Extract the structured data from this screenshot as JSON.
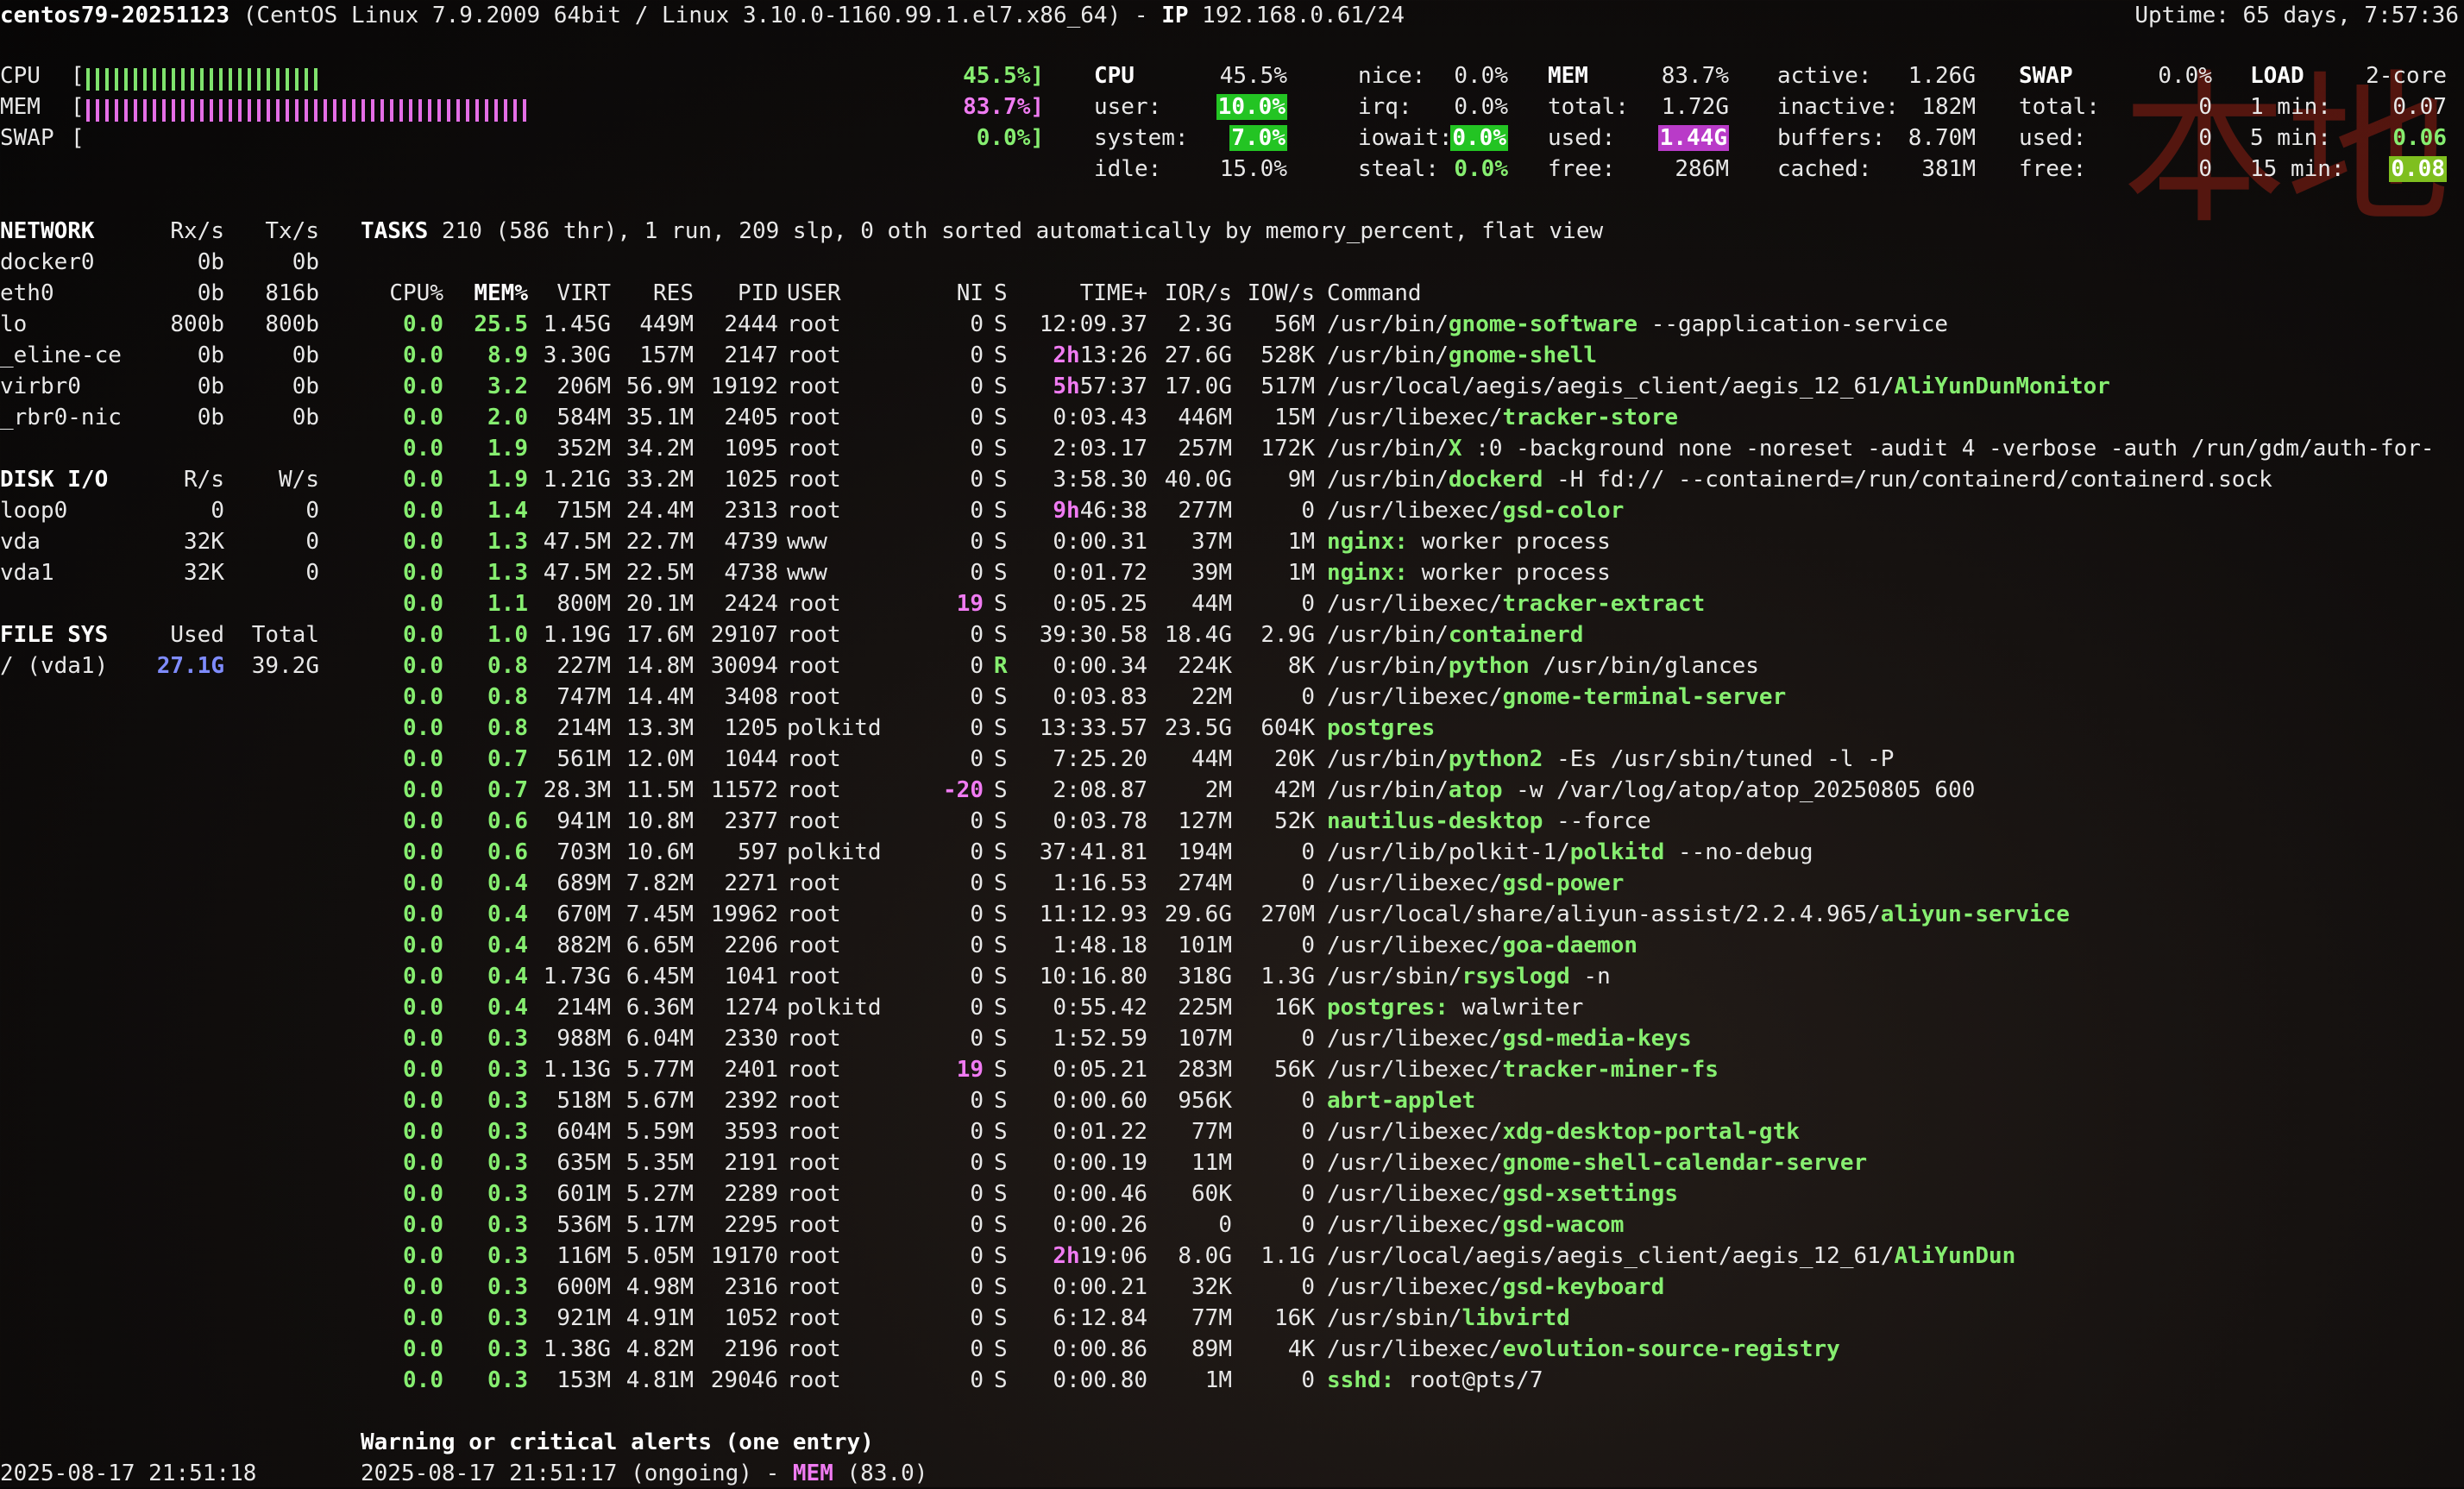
{
  "header": {
    "hostname": "centos79-20251123",
    "os": "(CentOS Linux 7.9.2009 64bit / Linux 3.10.0-1160.99.1.el7.x86_64) - ",
    "ip_label": "IP",
    "ip": "192.168.0.61/24",
    "uptime": "Uptime: 65 days, 7:57:36"
  },
  "quicklook": {
    "cpu_label": "CPU",
    "cpu_pct": "45.5%]",
    "cpu_fraction": 0.455,
    "mem_label": "MEM",
    "mem_pct": "83.7%]",
    "mem_fraction": 0.837,
    "swap_label": "SWAP",
    "swap_pct": "0.0%]",
    "swap_fraction": 0.0,
    "bracket_open": "[",
    "colors": {
      "cpu_bar": "#7fe36d",
      "mem_bar": "#e46ee6"
    }
  },
  "cpu": {
    "title": "CPU",
    "total": "45.5%",
    "user_label": "user:",
    "user": "10.0%",
    "system_label": "system:",
    "system": "7.0%",
    "idle_label": "idle:",
    "idle": "15.0%",
    "nice_label": "nice:",
    "nice": "0.0%",
    "irq_label": "irq:",
    "irq": "0.0%",
    "iowait_label": "iowait:",
    "iowait": "0.0%",
    "steal_label": "steal:",
    "steal": "0.0%"
  },
  "mem": {
    "title": "MEM",
    "total_pct": "83.7%",
    "total_label": "total:",
    "total": "1.72G",
    "used_label": "used:",
    "used": "1.44G",
    "free_label": "free:",
    "free": "286M",
    "active_label": "active:",
    "active": "1.26G",
    "inactive_label": "inactive:",
    "inactive": "182M",
    "buffers_label": "buffers:",
    "buffers": "8.70M",
    "cached_label": "cached:",
    "cached": "381M"
  },
  "swap": {
    "title": "SWAP",
    "pct": "0.0%",
    "total_label": "total:",
    "total": "0",
    "used_label": "used:",
    "used": "0",
    "free_label": "free:",
    "free": "0"
  },
  "load": {
    "title": "LOAD",
    "cores": "2-core",
    "min1_label": "1 min:",
    "min1": "0.07",
    "min5_label": "5 min:",
    "min5": "0.06",
    "min15_label": "15 min:",
    "min15": "0.08"
  },
  "watermark": "本地",
  "network": {
    "title": "NETWORK",
    "rx_label": "Rx/s",
    "tx_label": "Tx/s",
    "rows": [
      {
        "name": "docker0",
        "rx": "0b",
        "tx": "0b"
      },
      {
        "name": "eth0",
        "rx": "0b",
        "tx": "816b"
      },
      {
        "name": "lo",
        "rx": "800b",
        "tx": "800b"
      },
      {
        "name": "_eline-ce",
        "rx": "0b",
        "tx": "0b"
      },
      {
        "name": "virbr0",
        "rx": "0b",
        "tx": "0b"
      },
      {
        "name": "_rbr0-nic",
        "rx": "0b",
        "tx": "0b"
      }
    ]
  },
  "diskio": {
    "title": "DISK I/O",
    "r_label": "R/s",
    "w_label": "W/s",
    "rows": [
      {
        "name": "loop0",
        "r": "0",
        "w": "0"
      },
      {
        "name": "vda",
        "r": "32K",
        "w": "0"
      },
      {
        "name": "vda1",
        "r": "32K",
        "w": "0"
      }
    ]
  },
  "fs": {
    "title": "FILE SYS",
    "used_label": "Used",
    "total_label": "Total",
    "rows": [
      {
        "name": "/ (vda1)",
        "used": "27.1G",
        "total": "39.2G"
      }
    ]
  },
  "tasks": {
    "label": "TASKS",
    "summary": "210 (586 thr), 1 run, 209 slp, 0 oth sorted automatically by memory_percent, flat view"
  },
  "proc_headers": [
    "CPU%",
    "MEM%",
    "VIRT",
    "RES",
    "PID",
    "USER",
    "NI",
    "S",
    "TIME+",
    "IOR/s",
    "IOW/s",
    "Command"
  ],
  "processes": [
    {
      "cpu": "0.0",
      "mem": "25.5",
      "virt": "1.45G",
      "res": "449M",
      "pid": "2444",
      "user": "root",
      "ni": "0",
      "s": "S",
      "time_hi": "",
      "time": "12:09.37",
      "ior": "2.3G",
      "iow": "56M",
      "cmd_pre": "/usr/bin/",
      "cmd_bold": "gnome-software",
      "cmd_post": " --gapplication-service"
    },
    {
      "cpu": "0.0",
      "mem": "8.9",
      "virt": "3.30G",
      "res": "157M",
      "pid": "2147",
      "user": "root",
      "ni": "0",
      "s": "S",
      "time_hi": "2h",
      "time": "13:26",
      "ior": "27.6G",
      "iow": "528K",
      "cmd_pre": "/usr/bin/",
      "cmd_bold": "gnome-shell",
      "cmd_post": ""
    },
    {
      "cpu": "0.0",
      "mem": "3.2",
      "virt": "206M",
      "res": "56.9M",
      "pid": "19192",
      "user": "root",
      "ni": "0",
      "s": "S",
      "time_hi": "5h",
      "time": "57:37",
      "ior": "17.0G",
      "iow": "517M",
      "cmd_pre": "/usr/local/aegis/aegis_client/aegis_12_61/",
      "cmd_bold": "AliYunDunMonitor",
      "cmd_post": ""
    },
    {
      "cpu": "0.0",
      "mem": "2.0",
      "virt": "584M",
      "res": "35.1M",
      "pid": "2405",
      "user": "root",
      "ni": "0",
      "s": "S",
      "time_hi": "",
      "time": "0:03.43",
      "ior": "446M",
      "iow": "15M",
      "cmd_pre": "/usr/libexec/",
      "cmd_bold": "tracker-store",
      "cmd_post": ""
    },
    {
      "cpu": "0.0",
      "mem": "1.9",
      "virt": "352M",
      "res": "34.2M",
      "pid": "1095",
      "user": "root",
      "ni": "0",
      "s": "S",
      "time_hi": "",
      "time": "2:03.17",
      "ior": "257M",
      "iow": "172K",
      "cmd_pre": "/usr/bin/",
      "cmd_bold": "X",
      "cmd_post": " :0 -background none -noreset -audit 4 -verbose -auth /run/gdm/auth-for-"
    },
    {
      "cpu": "0.0",
      "mem": "1.9",
      "virt": "1.21G",
      "res": "33.2M",
      "pid": "1025",
      "user": "root",
      "ni": "0",
      "s": "S",
      "time_hi": "",
      "time": "3:58.30",
      "ior": "40.0G",
      "iow": "9M",
      "cmd_pre": "/usr/bin/",
      "cmd_bold": "dockerd",
      "cmd_post": " -H fd:// --containerd=/run/containerd/containerd.sock"
    },
    {
      "cpu": "0.0",
      "mem": "1.4",
      "virt": "715M",
      "res": "24.4M",
      "pid": "2313",
      "user": "root",
      "ni": "0",
      "s": "S",
      "time_hi": "9h",
      "time": "46:38",
      "ior": "277M",
      "iow": "0",
      "cmd_pre": "/usr/libexec/",
      "cmd_bold": "gsd-color",
      "cmd_post": ""
    },
    {
      "cpu": "0.0",
      "mem": "1.3",
      "virt": "47.5M",
      "res": "22.7M",
      "pid": "4739",
      "user": "www",
      "ni": "0",
      "s": "S",
      "time_hi": "",
      "time": "0:00.31",
      "ior": "37M",
      "iow": "1M",
      "cmd_pre": "",
      "cmd_bold": "nginx:",
      "cmd_post": " worker process"
    },
    {
      "cpu": "0.0",
      "mem": "1.3",
      "virt": "47.5M",
      "res": "22.5M",
      "pid": "4738",
      "user": "www",
      "ni": "0",
      "s": "S",
      "time_hi": "",
      "time": "0:01.72",
      "ior": "39M",
      "iow": "1M",
      "cmd_pre": "",
      "cmd_bold": "nginx:",
      "cmd_post": " worker process"
    },
    {
      "cpu": "0.0",
      "mem": "1.1",
      "virt": "800M",
      "res": "20.1M",
      "pid": "2424",
      "user": "root",
      "ni": "19",
      "s": "S",
      "time_hi": "",
      "time": "0:05.25",
      "ior": "44M",
      "iow": "0",
      "cmd_pre": "/usr/libexec/",
      "cmd_bold": "tracker-extract",
      "cmd_post": ""
    },
    {
      "cpu": "0.0",
      "mem": "1.0",
      "virt": "1.19G",
      "res": "17.6M",
      "pid": "29107",
      "user": "root",
      "ni": "0",
      "s": "S",
      "time_hi": "",
      "time": "39:30.58",
      "ior": "18.4G",
      "iow": "2.9G",
      "cmd_pre": "/usr/bin/",
      "cmd_bold": "containerd",
      "cmd_post": ""
    },
    {
      "cpu": "0.0",
      "mem": "0.8",
      "virt": "227M",
      "res": "14.8M",
      "pid": "30094",
      "user": "root",
      "ni": "0",
      "s": "R",
      "time_hi": "",
      "time": "0:00.34",
      "ior": "224K",
      "iow": "8K",
      "cmd_pre": "/usr/bin/",
      "cmd_bold": "python",
      "cmd_post": " /usr/bin/glances"
    },
    {
      "cpu": "0.0",
      "mem": "0.8",
      "virt": "747M",
      "res": "14.4M",
      "pid": "3408",
      "user": "root",
      "ni": "0",
      "s": "S",
      "time_hi": "",
      "time": "0:03.83",
      "ior": "22M",
      "iow": "0",
      "cmd_pre": "/usr/libexec/",
      "cmd_bold": "gnome-terminal-server",
      "cmd_post": ""
    },
    {
      "cpu": "0.0",
      "mem": "0.8",
      "virt": "214M",
      "res": "13.3M",
      "pid": "1205",
      "user": "polkitd",
      "ni": "0",
      "s": "S",
      "time_hi": "",
      "time": "13:33.57",
      "ior": "23.5G",
      "iow": "604K",
      "cmd_pre": "",
      "cmd_bold": "postgres",
      "cmd_post": ""
    },
    {
      "cpu": "0.0",
      "mem": "0.7",
      "virt": "561M",
      "res": "12.0M",
      "pid": "1044",
      "user": "root",
      "ni": "0",
      "s": "S",
      "time_hi": "",
      "time": "7:25.20",
      "ior": "44M",
      "iow": "20K",
      "cmd_pre": "/usr/bin/",
      "cmd_bold": "python2",
      "cmd_post": " -Es /usr/sbin/tuned -l -P"
    },
    {
      "cpu": "0.0",
      "mem": "0.7",
      "virt": "28.3M",
      "res": "11.5M",
      "pid": "11572",
      "user": "root",
      "ni": "-20",
      "s": "S",
      "time_hi": "",
      "time": "2:08.87",
      "ior": "2M",
      "iow": "42M",
      "cmd_pre": "/usr/bin/",
      "cmd_bold": "atop",
      "cmd_post": " -w /var/log/atop/atop_20250805 600"
    },
    {
      "cpu": "0.0",
      "mem": "0.6",
      "virt": "941M",
      "res": "10.8M",
      "pid": "2377",
      "user": "root",
      "ni": "0",
      "s": "S",
      "time_hi": "",
      "time": "0:03.78",
      "ior": "127M",
      "iow": "52K",
      "cmd_pre": "",
      "cmd_bold": "nautilus-desktop",
      "cmd_post": " --force"
    },
    {
      "cpu": "0.0",
      "mem": "0.6",
      "virt": "703M",
      "res": "10.6M",
      "pid": "597",
      "user": "polkitd",
      "ni": "0",
      "s": "S",
      "time_hi": "",
      "time": "37:41.81",
      "ior": "194M",
      "iow": "0",
      "cmd_pre": "/usr/lib/polkit-1/",
      "cmd_bold": "polkitd",
      "cmd_post": " --no-debug"
    },
    {
      "cpu": "0.0",
      "mem": "0.4",
      "virt": "689M",
      "res": "7.82M",
      "pid": "2271",
      "user": "root",
      "ni": "0",
      "s": "S",
      "time_hi": "",
      "time": "1:16.53",
      "ior": "274M",
      "iow": "0",
      "cmd_pre": "/usr/libexec/",
      "cmd_bold": "gsd-power",
      "cmd_post": ""
    },
    {
      "cpu": "0.0",
      "mem": "0.4",
      "virt": "670M",
      "res": "7.45M",
      "pid": "19962",
      "user": "root",
      "ni": "0",
      "s": "S",
      "time_hi": "",
      "time": "11:12.93",
      "ior": "29.6G",
      "iow": "270M",
      "cmd_pre": "/usr/local/share/aliyun-assist/2.2.4.965/",
      "cmd_bold": "aliyun-service",
      "cmd_post": ""
    },
    {
      "cpu": "0.0",
      "mem": "0.4",
      "virt": "882M",
      "res": "6.65M",
      "pid": "2206",
      "user": "root",
      "ni": "0",
      "s": "S",
      "time_hi": "",
      "time": "1:48.18",
      "ior": "101M",
      "iow": "0",
      "cmd_pre": "/usr/libexec/",
      "cmd_bold": "goa-daemon",
      "cmd_post": ""
    },
    {
      "cpu": "0.0",
      "mem": "0.4",
      "virt": "1.73G",
      "res": "6.45M",
      "pid": "1041",
      "user": "root",
      "ni": "0",
      "s": "S",
      "time_hi": "",
      "time": "10:16.80",
      "ior": "318G",
      "iow": "1.3G",
      "cmd_pre": "/usr/sbin/",
      "cmd_bold": "rsyslogd",
      "cmd_post": " -n"
    },
    {
      "cpu": "0.0",
      "mem": "0.4",
      "virt": "214M",
      "res": "6.36M",
      "pid": "1274",
      "user": "polkitd",
      "ni": "0",
      "s": "S",
      "time_hi": "",
      "time": "0:55.42",
      "ior": "225M",
      "iow": "16K",
      "cmd_pre": "",
      "cmd_bold": "postgres:",
      "cmd_post": " walwriter"
    },
    {
      "cpu": "0.0",
      "mem": "0.3",
      "virt": "988M",
      "res": "6.04M",
      "pid": "2330",
      "user": "root",
      "ni": "0",
      "s": "S",
      "time_hi": "",
      "time": "1:52.59",
      "ior": "107M",
      "iow": "0",
      "cmd_pre": "/usr/libexec/",
      "cmd_bold": "gsd-media-keys",
      "cmd_post": ""
    },
    {
      "cpu": "0.0",
      "mem": "0.3",
      "virt": "1.13G",
      "res": "5.77M",
      "pid": "2401",
      "user": "root",
      "ni": "19",
      "s": "S",
      "time_hi": "",
      "time": "0:05.21",
      "ior": "283M",
      "iow": "56K",
      "cmd_pre": "/usr/libexec/",
      "cmd_bold": "tracker-miner-fs",
      "cmd_post": ""
    },
    {
      "cpu": "0.0",
      "mem": "0.3",
      "virt": "518M",
      "res": "5.67M",
      "pid": "2392",
      "user": "root",
      "ni": "0",
      "s": "S",
      "time_hi": "",
      "time": "0:00.60",
      "ior": "956K",
      "iow": "0",
      "cmd_pre": "",
      "cmd_bold": "abrt-applet",
      "cmd_post": ""
    },
    {
      "cpu": "0.0",
      "mem": "0.3",
      "virt": "604M",
      "res": "5.59M",
      "pid": "3593",
      "user": "root",
      "ni": "0",
      "s": "S",
      "time_hi": "",
      "time": "0:01.22",
      "ior": "77M",
      "iow": "0",
      "cmd_pre": "/usr/libexec/",
      "cmd_bold": "xdg-desktop-portal-gtk",
      "cmd_post": ""
    },
    {
      "cpu": "0.0",
      "mem": "0.3",
      "virt": "635M",
      "res": "5.35M",
      "pid": "2191",
      "user": "root",
      "ni": "0",
      "s": "S",
      "time_hi": "",
      "time": "0:00.19",
      "ior": "11M",
      "iow": "0",
      "cmd_pre": "/usr/libexec/",
      "cmd_bold": "gnome-shell-calendar-server",
      "cmd_post": ""
    },
    {
      "cpu": "0.0",
      "mem": "0.3",
      "virt": "601M",
      "res": "5.27M",
      "pid": "2289",
      "user": "root",
      "ni": "0",
      "s": "S",
      "time_hi": "",
      "time": "0:00.46",
      "ior": "60K",
      "iow": "0",
      "cmd_pre": "/usr/libexec/",
      "cmd_bold": "gsd-xsettings",
      "cmd_post": ""
    },
    {
      "cpu": "0.0",
      "mem": "0.3",
      "virt": "536M",
      "res": "5.17M",
      "pid": "2295",
      "user": "root",
      "ni": "0",
      "s": "S",
      "time_hi": "",
      "time": "0:00.26",
      "ior": "0",
      "iow": "0",
      "cmd_pre": "/usr/libexec/",
      "cmd_bold": "gsd-wacom",
      "cmd_post": ""
    },
    {
      "cpu": "0.0",
      "mem": "0.3",
      "virt": "116M",
      "res": "5.05M",
      "pid": "19170",
      "user": "root",
      "ni": "0",
      "s": "S",
      "time_hi": "2h",
      "time": "19:06",
      "ior": "8.0G",
      "iow": "1.1G",
      "cmd_pre": "/usr/local/aegis/aegis_client/aegis_12_61/",
      "cmd_bold": "AliYunDun",
      "cmd_post": ""
    },
    {
      "cpu": "0.0",
      "mem": "0.3",
      "virt": "600M",
      "res": "4.98M",
      "pid": "2316",
      "user": "root",
      "ni": "0",
      "s": "S",
      "time_hi": "",
      "time": "0:00.21",
      "ior": "32K",
      "iow": "0",
      "cmd_pre": "/usr/libexec/",
      "cmd_bold": "gsd-keyboard",
      "cmd_post": ""
    },
    {
      "cpu": "0.0",
      "mem": "0.3",
      "virt": "921M",
      "res": "4.91M",
      "pid": "1052",
      "user": "root",
      "ni": "0",
      "s": "S",
      "time_hi": "",
      "time": "6:12.84",
      "ior": "77M",
      "iow": "16K",
      "cmd_pre": "/usr/sbin/",
      "cmd_bold": "libvirtd",
      "cmd_post": ""
    },
    {
      "cpu": "0.0",
      "mem": "0.3",
      "virt": "1.38G",
      "res": "4.82M",
      "pid": "2196",
      "user": "root",
      "ni": "0",
      "s": "S",
      "time_hi": "",
      "time": "0:00.86",
      "ior": "89M",
      "iow": "4K",
      "cmd_pre": "/usr/libexec/",
      "cmd_bold": "evolution-source-registry",
      "cmd_post": ""
    },
    {
      "cpu": "0.0",
      "mem": "0.3",
      "virt": "153M",
      "res": "4.81M",
      "pid": "29046",
      "user": "root",
      "ni": "0",
      "s": "S",
      "time_hi": "",
      "time": "0:00.80",
      "ior": "1M",
      "iow": "0",
      "cmd_pre": "",
      "cmd_bold": "sshd:",
      "cmd_post": " root@pts/7"
    }
  ],
  "alerts": {
    "title": "Warning or critical alerts (one entry)",
    "entry_pre": "2025-08-17 21:51:17 (ongoing) - ",
    "entry_key": "MEM",
    "entry_post": " (83.0)"
  },
  "footer": {
    "datetime": "2025-08-17 21:51:18"
  }
}
